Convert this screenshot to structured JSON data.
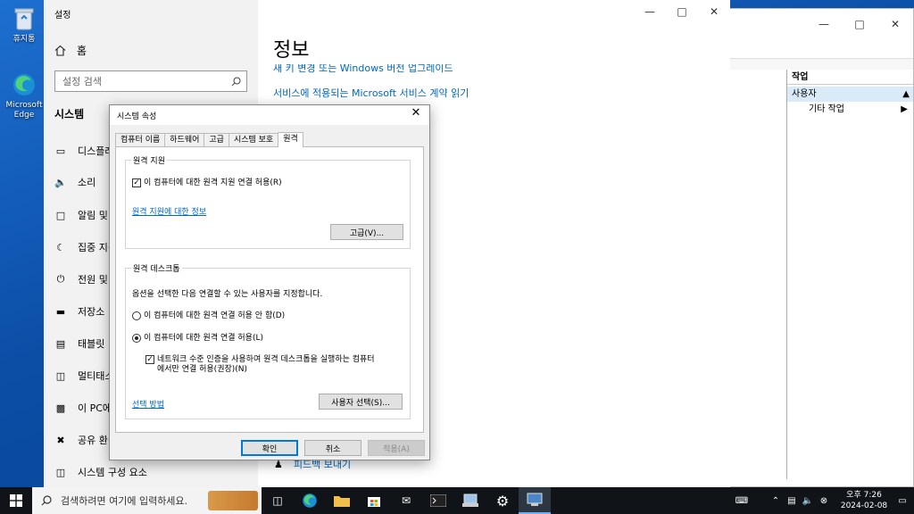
{
  "desktop": {
    "icons": [
      {
        "label": "휴지통"
      },
      {
        "label": "Microsoft Edge"
      }
    ]
  },
  "mmc": {
    "actions_header": "작업",
    "section": "사용자",
    "item": "기타 작업"
  },
  "settings": {
    "app_title": "설정",
    "home": "홈",
    "search_placeholder": "설정 검색",
    "section": "시스템",
    "nav": [
      "디스플레이",
      "소리",
      "알림 및 작업",
      "집중 지원",
      "전원 및 절전",
      "저장소",
      "태블릿",
      "멀티태스킹",
      "이 PC에 프로젝션",
      "공유 환경",
      "시스템 구성 요소"
    ],
    "page_title": "정보",
    "links": [
      "새 키 변경 또는 Windows 버전 업그레이드",
      "서비스에 적용되는 Microsoft 서비스 계약 읽기"
    ],
    "feedback": "피드백 보내기"
  },
  "dialog": {
    "title": "시스템 속성",
    "tabs": [
      "컴퓨터 이름",
      "하드웨어",
      "고급",
      "시스템 보호",
      "원격"
    ],
    "remote_assistance": {
      "legend": "원격 지원",
      "allow": "이 컴퓨터에 대한 원격 지원 연결 허용(R)",
      "info_link": "원격 지원에 대한 정보",
      "advanced_btn": "고급(V)..."
    },
    "remote_desktop": {
      "legend": "원격 데스크톱",
      "description": "옵션을 선택한 다음 연결할 수 있는 사용자를 지정합니다.",
      "deny": "이 컴퓨터에 대한 원격 연결 허용 안 함(D)",
      "allow": "이 컴퓨터에 대한 원격 연결 허용(L)",
      "nla_line1": "네트워크 수준 인증을 사용하여 원격 데스크톱을 실행하는 컴퓨터",
      "nla_line2": "에서만 연결 허용(권장)(N)",
      "help_link": "선택 방법",
      "select_users_btn": "사용자 선택(S)..."
    },
    "ok": "확인",
    "cancel": "취소",
    "apply": "적용(A)"
  },
  "taskbar": {
    "search_placeholder": "검색하려면 여기에 입력하세요.",
    "clock_time": "오후 7:26",
    "clock_date": "2024-02-08"
  },
  "colors": {
    "accent": "#0078d7",
    "link": "#0067c0",
    "taskbar": "#101418"
  }
}
